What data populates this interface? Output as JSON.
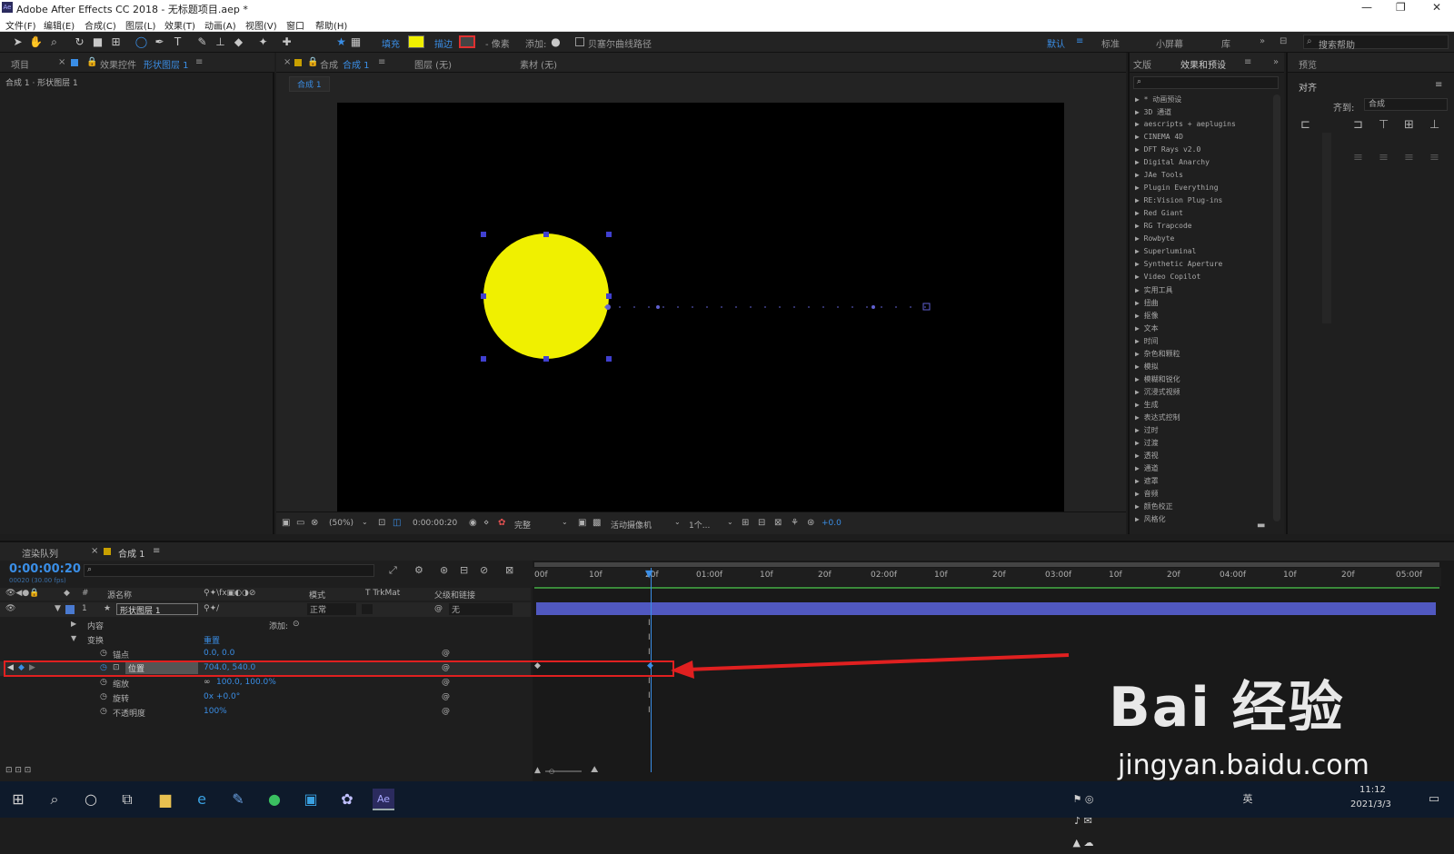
{
  "window": {
    "title": "Adobe After Effects CC 2018 - 无标题项目.aep *"
  },
  "menu": [
    "文件(F)",
    "编辑(E)",
    "合成(C)",
    "图层(L)",
    "效果(T)",
    "动画(A)",
    "视图(V)",
    "窗口",
    "帮助(H)"
  ],
  "toolbar": {
    "fill_label": "填充",
    "stroke_label": "描边",
    "px_label": "- 像素",
    "add_label": "添加:",
    "bezier_label": "贝塞尔曲线路径",
    "workspaces": [
      "默认",
      "标准",
      "小屏幕",
      "库"
    ],
    "search_placeholder": "搜索帮助",
    "fill_color": "#f0f000",
    "stroke_color": "#e03030"
  },
  "left_panel": {
    "tab_project": "项目",
    "tab_effects": "效果控件",
    "tab_effects_layer": "形状图层 1",
    "breadcrumb": "合成 1 · 形状图层 1"
  },
  "viewer": {
    "tab_comp_label": "合成",
    "tab_comp_name": "合成 1",
    "tab_layer": "图层 (无)",
    "tab_footage": "素材 (无)",
    "comp_tab_chip": "合成 1",
    "zoom": "(50%)",
    "timecode": "0:00:00:20",
    "quality": "完整",
    "camera": "活动摄像机",
    "views": "1个...",
    "offset": "+0.0"
  },
  "effects_panel": {
    "tab_info": "文版",
    "tab_effects": "效果和预设",
    "items": [
      "* 动画预设",
      "3D 通道",
      "aescripts + aeplugins",
      "CINEMA 4D",
      "DFT Rays v2.0",
      "Digital Anarchy",
      "JAe Tools",
      "Plugin Everything",
      "RE:Vision Plug-ins",
      "Red Giant",
      "RG Trapcode",
      "Rowbyte",
      "Superluminal",
      "Synthetic Aperture",
      "Video Copilot",
      "实用工具",
      "扭曲",
      "抠像",
      "文本",
      "时间",
      "杂色和颗粒",
      "模拟",
      "模糊和锐化",
      "沉浸式视频",
      "生成",
      "表达式控制",
      "过时",
      "过渡",
      "透视",
      "通道",
      "遮罩",
      "音频",
      "颜色校正",
      "风格化"
    ]
  },
  "align_panel": {
    "tab_preview": "预览",
    "tab_align": "对齐",
    "align_to_label": "齐到:",
    "align_to_value": "合成"
  },
  "timeline": {
    "tab_render": "渲染队列",
    "tab_comp": "合成 1",
    "current_time": "0:00:00:20",
    "fps": "00020 (30.00 fps)",
    "col_source": "源名称",
    "col_mode": "模式",
    "col_trkmat": "T  TrkMat",
    "col_parent": "父级和链接",
    "layer_name": "形状图层 1",
    "layer_num": "1",
    "layer_mode": "正常",
    "layer_parent": "无",
    "contents": "内容",
    "add": "添加:",
    "transform": "变换",
    "reset": "重置",
    "props": [
      {
        "name": "锚点",
        "value": "0.0, 0.0"
      },
      {
        "name": "位置",
        "value": "704.0, 540.0"
      },
      {
        "name": "缩放",
        "value": "100.0, 100.0%"
      },
      {
        "name": "旋转",
        "value": "0x +0.0°"
      },
      {
        "name": "不透明度",
        "value": "100%"
      }
    ],
    "ruler": [
      "00f",
      "10f",
      "20f",
      "01:00f",
      "10f",
      "20f",
      "02:00f",
      "10f",
      "20f",
      "03:00f",
      "10f",
      "20f",
      "04:00f",
      "10f",
      "20f",
      "05:00f"
    ]
  },
  "taskbar": {
    "time": "11:12",
    "date": "2021/3/3",
    "lang": "英"
  },
  "watermark": {
    "line1": "Bai 经验",
    "line2": "jingyan.baidu.com"
  }
}
